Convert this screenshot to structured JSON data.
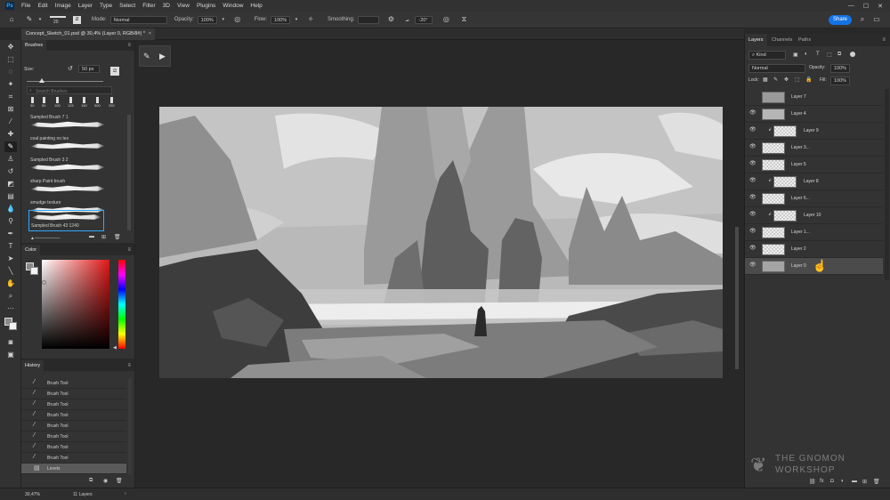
{
  "menubar": {
    "logo": "Ps",
    "items": [
      "File",
      "Edit",
      "Image",
      "Layer",
      "Type",
      "Select",
      "Filter",
      "3D",
      "View",
      "Plugins",
      "Window",
      "Help"
    ],
    "window_controls": [
      "—",
      "☐",
      "✕"
    ]
  },
  "options": {
    "brush_size": "20",
    "mode_label": "Mode:",
    "mode_value": "Normal",
    "opacity_label": "Opacity:",
    "opacity_value": "100%",
    "flow_label": "Flow:",
    "flow_value": "100%",
    "smoothing_label": "Smoothing:",
    "angle_value": "-20°",
    "share_label": "Share"
  },
  "document": {
    "tab_title": "Concept_Sketch_01.psd @ 30,4% (Layer 0, RGB/8#) *",
    "close": "×"
  },
  "brushes": {
    "panel_title": "Brushes",
    "size_label": "Size:",
    "size_value": "50 px",
    "search_placeholder": "Search Brushes",
    "preset_sizes": [
      "30",
      "50",
      "100",
      "125",
      "150",
      "500",
      "250"
    ],
    "items": [
      {
        "name": "Sampled Brush 7 1"
      },
      {
        "name": "coal painting no tex"
      },
      {
        "name": "Sampled Brush 3 2"
      },
      {
        "name": "sharp Paint brush"
      },
      {
        "name": "smudge texture"
      },
      {
        "name": "Sampled Brush 43 1240"
      }
    ]
  },
  "color": {
    "panel_title": "Color",
    "accent": "#31a8ff"
  },
  "history": {
    "panel_title": "History",
    "items": [
      "Brush Tool",
      "Brush Tool",
      "Brush Tool",
      "Brush Tool",
      "Brush Tool",
      "Brush Tool",
      "Brush Tool",
      "Brush Tool",
      "Levels"
    ]
  },
  "layers": {
    "tabs": [
      "Layers",
      "Channels",
      "Paths"
    ],
    "filter_label": "Kind",
    "blend_mode": "Normal",
    "opacity_label": "Opacity:",
    "opacity_value": "100%",
    "lock_label": "Lock:",
    "fill_label": "Fill:",
    "fill_value": "100%",
    "items": [
      {
        "name": "Layer 7"
      },
      {
        "name": "Layer 4"
      },
      {
        "name": "Layer 9"
      },
      {
        "name": "Layer 3..."
      },
      {
        "name": "Layer 5"
      },
      {
        "name": "Layer 8"
      },
      {
        "name": "Layer 6..."
      },
      {
        "name": "Layer 10"
      },
      {
        "name": "Layer 1..."
      },
      {
        "name": "Layer 2"
      },
      {
        "name": "Layer 0"
      }
    ]
  },
  "status": {
    "zoom": "30,47%",
    "layers_count": "11 Layers"
  },
  "watermark": {
    "line1": "THE GNOMON",
    "line2": "WORKSHOP"
  }
}
